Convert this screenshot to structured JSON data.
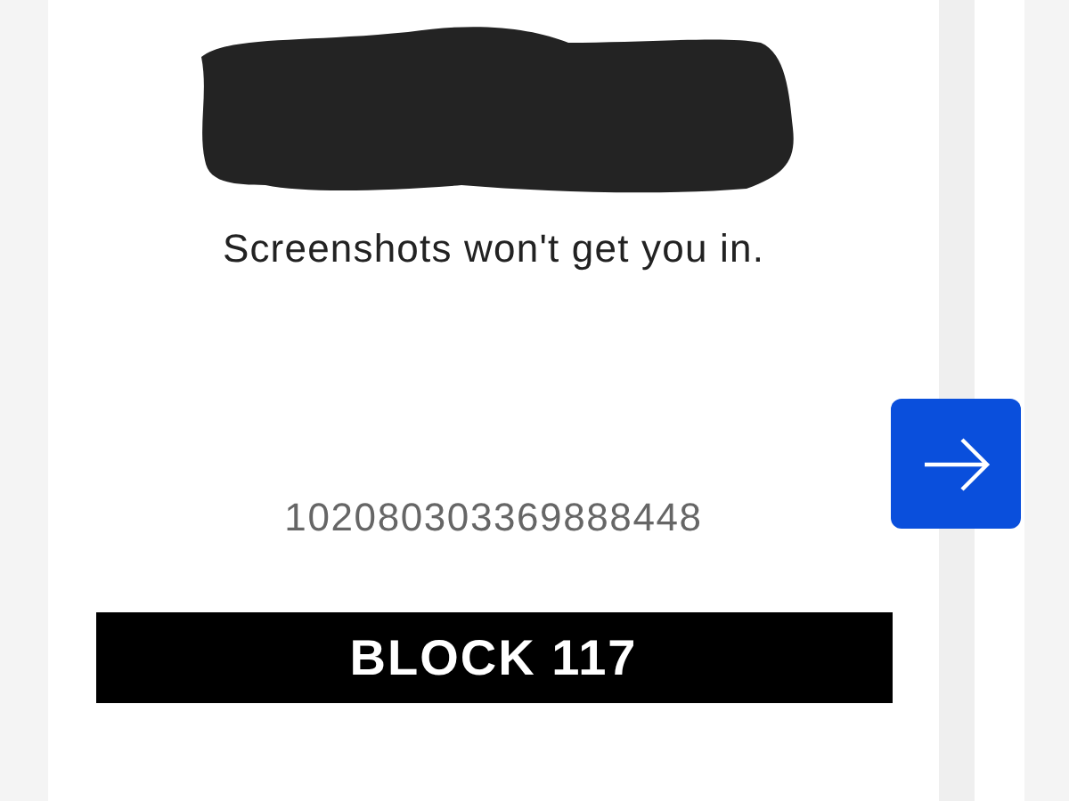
{
  "ticket": {
    "notice": "Screenshots won't get you in.",
    "barcode_number": "102080303369888448",
    "section": "BLOCK 117"
  }
}
